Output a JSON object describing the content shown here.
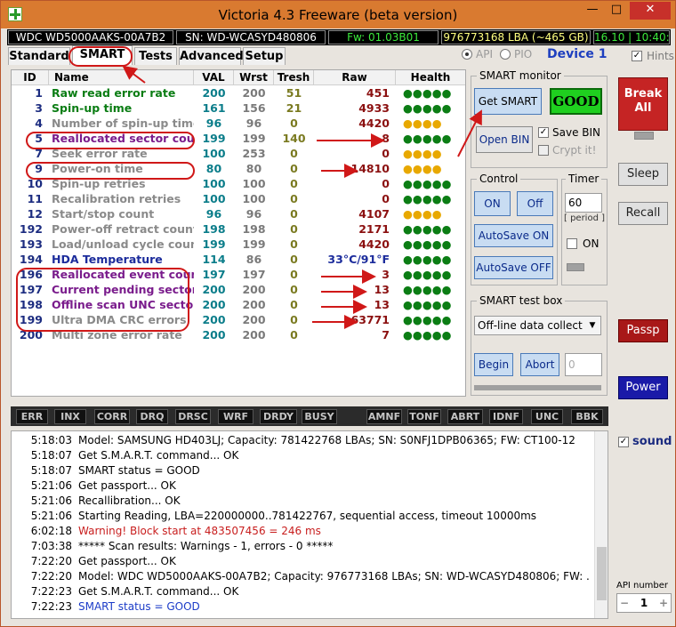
{
  "window": {
    "title": "Victoria 4.3 Freeware (beta version)",
    "minimize": "—",
    "maximize": "□",
    "close": "✕"
  },
  "infobar": {
    "model": "WDC WD5000AAKS-00A7B2",
    "serial": "SN: WD-WCASYD480806",
    "firmware": "Fw: 01.03B01",
    "capacity": "976773168 LBA (~465 GB)",
    "time": "16.10 | 10:40:0"
  },
  "tabs": [
    {
      "label": "Standard"
    },
    {
      "label": "SMART"
    },
    {
      "label": "Tests"
    },
    {
      "label": "Advanced"
    },
    {
      "label": "Setup"
    }
  ],
  "mode": {
    "api_label": "API",
    "pio_label": "PIO",
    "selected": "API",
    "device": "Device 1",
    "hints_label": "Hints",
    "hints_checked": true
  },
  "smart_table": {
    "columns": [
      "ID",
      "Name",
      "VAL",
      "Wrst",
      "Tresh",
      "Raw",
      "Health"
    ],
    "rows": [
      {
        "id": "1",
        "name": "Raw read error rate",
        "val": "200",
        "wrst": "200",
        "tresh": "51",
        "raw": "451",
        "health": "●●●●●",
        "name_color": "#0b7d14",
        "health_color": "#0b7d14"
      },
      {
        "id": "3",
        "name": "Spin-up time",
        "val": "161",
        "wrst": "156",
        "tresh": "21",
        "raw": "4933",
        "health": "●●●●●",
        "name_color": "#0b7d14",
        "health_color": "#0b7d14"
      },
      {
        "id": "4",
        "name": "Number of spin-up times",
        "val": "96",
        "wrst": "96",
        "tresh": "0",
        "raw": "4420",
        "health": "●●●●",
        "name_color": "#8a8a8a",
        "health_color": "#e8a800"
      },
      {
        "id": "5",
        "name": "Reallocated sector count",
        "val": "199",
        "wrst": "199",
        "tresh": "140",
        "raw": "8",
        "health": "●●●●●",
        "name_color": "#7a1c8c",
        "health_color": "#0b7d14"
      },
      {
        "id": "7",
        "name": "Seek error rate",
        "val": "100",
        "wrst": "253",
        "tresh": "0",
        "raw": "0",
        "health": "●●●●",
        "name_color": "#8a8a8a",
        "health_color": "#e8a800"
      },
      {
        "id": "9",
        "name": "Power-on time",
        "val": "80",
        "wrst": "80",
        "tresh": "0",
        "raw": "14810",
        "health": "●●●●",
        "name_color": "#8a8a8a",
        "health_color": "#e8a800"
      },
      {
        "id": "10",
        "name": "Spin-up retries",
        "val": "100",
        "wrst": "100",
        "tresh": "0",
        "raw": "0",
        "health": "●●●●●",
        "name_color": "#8a8a8a",
        "health_color": "#0b7d14"
      },
      {
        "id": "11",
        "name": "Recalibration retries",
        "val": "100",
        "wrst": "100",
        "tresh": "0",
        "raw": "0",
        "health": "●●●●●",
        "name_color": "#8a8a8a",
        "health_color": "#0b7d14"
      },
      {
        "id": "12",
        "name": "Start/stop count",
        "val": "96",
        "wrst": "96",
        "tresh": "0",
        "raw": "4107",
        "health": "●●●●",
        "name_color": "#8a8a8a",
        "health_color": "#e8a800"
      },
      {
        "id": "192",
        "name": "Power-off retract count",
        "val": "198",
        "wrst": "198",
        "tresh": "0",
        "raw": "2171",
        "health": "●●●●●",
        "name_color": "#8a8a8a",
        "health_color": "#0b7d14"
      },
      {
        "id": "193",
        "name": "Load/unload cycle count",
        "val": "199",
        "wrst": "199",
        "tresh": "0",
        "raw": "4420",
        "health": "●●●●●",
        "name_color": "#8a8a8a",
        "health_color": "#0b7d14"
      },
      {
        "id": "194",
        "name": "HDA Temperature",
        "val": "114",
        "wrst": "86",
        "tresh": "0",
        "raw": "33°C/91°F",
        "health": "●●●●●",
        "name_color": "#1c2c9c",
        "health_color": "#0b7d14"
      },
      {
        "id": "196",
        "name": "Reallocated event count",
        "val": "197",
        "wrst": "197",
        "tresh": "0",
        "raw": "3",
        "health": "●●●●●",
        "name_color": "#7a1c8c",
        "health_color": "#0b7d14"
      },
      {
        "id": "197",
        "name": "Current pending sectors",
        "val": "200",
        "wrst": "200",
        "tresh": "0",
        "raw": "13",
        "health": "●●●●●",
        "name_color": "#7a1c8c",
        "health_color": "#0b7d14"
      },
      {
        "id": "198",
        "name": "Offline scan UNC sectors",
        "val": "200",
        "wrst": "200",
        "tresh": "0",
        "raw": "13",
        "health": "●●●●●",
        "name_color": "#7a1c8c",
        "health_color": "#0b7d14"
      },
      {
        "id": "199",
        "name": "Ultra DMA CRC errors",
        "val": "200",
        "wrst": "200",
        "tresh": "0",
        "raw": "63771",
        "health": "●●●●●",
        "name_color": "#8a8a8a",
        "health_color": "#0b7d14"
      },
      {
        "id": "200",
        "name": "Multi zone error rate",
        "val": "200",
        "wrst": "200",
        "tresh": "0",
        "raw": "7",
        "health": "●●●●●",
        "name_color": "#8a8a8a",
        "health_color": "#0b7d14"
      }
    ]
  },
  "smart_monitor": {
    "title": "SMART monitor",
    "get_smart_label": "Get SMART",
    "status": "GOOD",
    "open_bin_label": "Open BIN",
    "save_bin_label": "Save BIN",
    "save_bin_checked": true,
    "crypt_label": "Crypt it!",
    "crypt_checked": false
  },
  "control": {
    "title": "Control",
    "on_label": "ON",
    "off_label": "Off",
    "autosave_on_label": "AutoSave ON",
    "autosave_off_label": "AutoSave OFF"
  },
  "timer": {
    "title": "Timer",
    "value": "60",
    "period_label": "[ period ]",
    "on_label": "ON"
  },
  "test_box": {
    "title": "SMART test box",
    "selected_test": "Off-line data collect",
    "begin_label": "Begin",
    "abort_label": "Abort",
    "value": "0"
  },
  "side_buttons": {
    "break_label": "Break All",
    "sleep_label": "Sleep",
    "recall_label": "Recall",
    "passp_label": "Passp",
    "power_label": "Power",
    "sound_label": "sound",
    "sound_checked": true,
    "api_number_label": "API number",
    "api_number_value": "1"
  },
  "status_flags": [
    "ERR",
    "INX",
    "CORR",
    "DRQ",
    "DRSC",
    "WRF",
    "DRDY",
    "BUSY",
    "AMNF",
    "TONF",
    "ABRT",
    "IDNF",
    "UNC",
    "BBK"
  ],
  "log": [
    {
      "time": "5:18:03",
      "msg": "Model: SAMSUNG HD403LJ; Capacity: 781422768 LBAs; SN: S0NFJ1DPB06365; FW: CT100-12",
      "color": "#000000"
    },
    {
      "time": "5:18:07",
      "msg": "Get S.M.A.R.T. command... OK",
      "color": "#000000"
    },
    {
      "time": "5:18:07",
      "msg": "SMART status = GOOD",
      "color": "#000000"
    },
    {
      "time": "5:21:06",
      "msg": "Get passport... OK",
      "color": "#000000"
    },
    {
      "time": "5:21:06",
      "msg": "Recallibration... OK",
      "color": "#000000"
    },
    {
      "time": "5:21:06",
      "msg": "Starting Reading, LBA=220000000..781422767, sequential access, timeout 10000ms",
      "color": "#000000"
    },
    {
      "time": "6:02:18",
      "msg": "Warning! Block start at 483507456 = 246 ms",
      "color": "#c81e1e"
    },
    {
      "time": "7:03:38",
      "msg": "***** Scan results: Warnings - 1, errors - 0 *****",
      "color": "#000000"
    },
    {
      "time": "7:22:20",
      "msg": "Get passport... OK",
      "color": "#000000"
    },
    {
      "time": "7:22:20",
      "msg": "Model: WDC WD5000AAKS-00A7B2; Capacity: 976773168 LBAs; SN: WD-WCASYD480806; FW: ...",
      "color": "#000000"
    },
    {
      "time": "7:22:23",
      "msg": "Get S.M.A.R.T. command... OK",
      "color": "#000000"
    },
    {
      "time": "7:22:23",
      "msg": "SMART status = GOOD",
      "color": "#1c3cc8"
    }
  ]
}
